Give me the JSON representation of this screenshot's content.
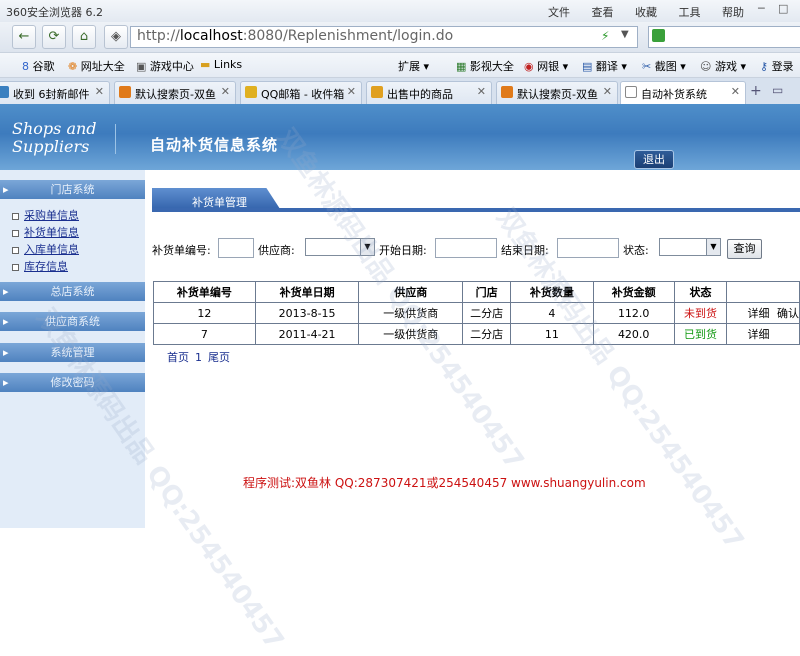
{
  "browser": {
    "title": "360安全浏览器 6.2",
    "menu": [
      "文件",
      "查看",
      "收藏",
      "工具",
      "帮助"
    ],
    "url_prefix": "http://",
    "url_host": "localhost",
    "url_rest": ":8080/Replenishment/login.do",
    "favorites": [
      "谷歌",
      "网址大全",
      "游戏中心",
      "Links",
      "扩展",
      "影视大全",
      "网银",
      "翻译",
      "截图",
      "游戏",
      "登录"
    ],
    "tabs": [
      {
        "label": "收到 6封新邮件"
      },
      {
        "label": "默认搜索页-双鱼"
      },
      {
        "label": "QQ邮箱 - 收件箱"
      },
      {
        "label": "出售中的商品"
      },
      {
        "label": "默认搜索页-双鱼"
      },
      {
        "label": "自动补货系统"
      }
    ]
  },
  "header": {
    "logo_line1": "Shops and",
    "logo_line2": "Suppliers",
    "system_title": "自动补货信息系统",
    "logout_label": "退出"
  },
  "sidebar": {
    "sections": [
      {
        "label": "门店系统"
      },
      {
        "label": "总店系统"
      },
      {
        "label": "供应商系统"
      },
      {
        "label": "系统管理"
      },
      {
        "label": "修改密码"
      }
    ],
    "links": [
      "采购单信息",
      "补货单信息",
      "入库单信息",
      "库存信息"
    ]
  },
  "panel": {
    "title": "补货单管理"
  },
  "filters": {
    "order_no_label": "补货单编号:",
    "supplier_label": "供应商:",
    "start_label": "开始日期:",
    "end_label": "结束日期:",
    "status_label": "状态:",
    "query_label": "查询"
  },
  "table": {
    "headers": [
      "补货单编号",
      "补货单日期",
      "供应商",
      "门店",
      "补货数量",
      "补货金额",
      "状态",
      ""
    ],
    "rows": [
      {
        "no": "12",
        "date": "2013-8-15",
        "supplier": "一级供货商",
        "store": "二分店",
        "qty": "4",
        "amount": "112.0",
        "status": "未到货",
        "action1": "详细",
        "action2": "确认"
      },
      {
        "no": "7",
        "date": "2011-4-21",
        "supplier": "一级供货商",
        "store": "二分店",
        "qty": "11",
        "amount": "420.0",
        "status": "已到货",
        "action1": "详细",
        "action2": ""
      }
    ]
  },
  "pager": {
    "first": "首页",
    "page": "1",
    "last": "尾页"
  },
  "footer": {
    "text": "程序测试:双鱼林 QQ:287307421或254540457 www.shuangyulin.com"
  },
  "watermark": {
    "text": "双鱼林源码出品 QQ:254540457"
  },
  "colors": {
    "banner": "#3d7bbd",
    "status_pending": "#cc1111",
    "status_arrived": "#119911",
    "footer": "#cc1111"
  }
}
